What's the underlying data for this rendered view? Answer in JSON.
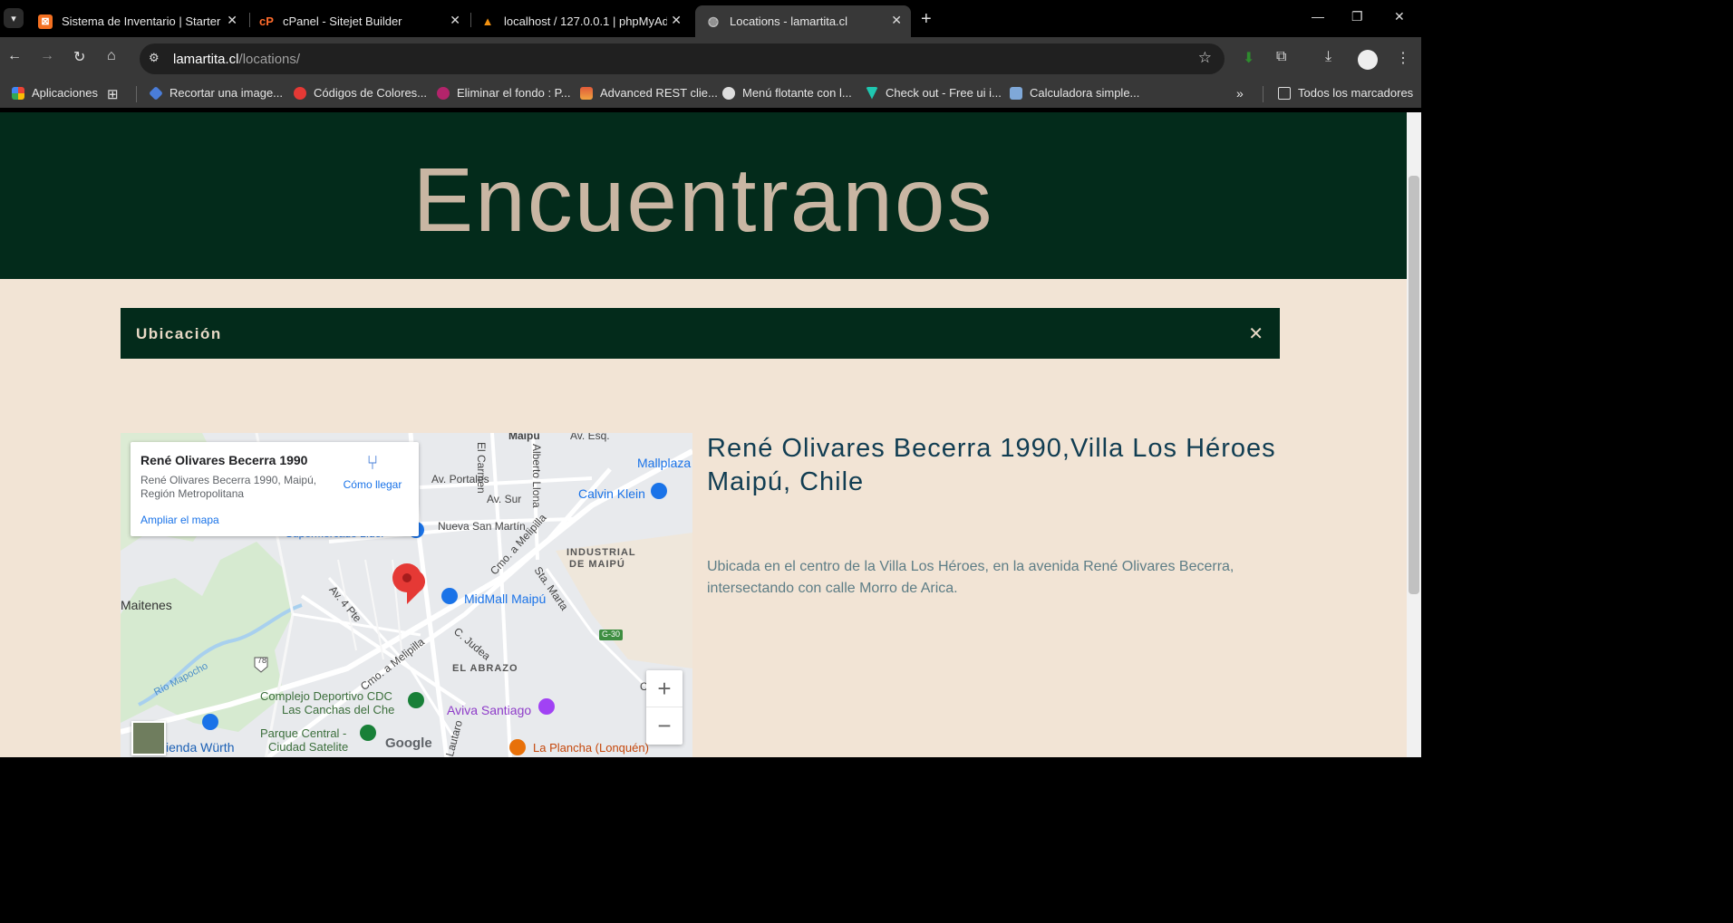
{
  "browser": {
    "tabs": [
      {
        "title": "Sistema de Inventario | Starter",
        "active": false
      },
      {
        "title": "cPanel - Sitejet Builder",
        "active": false
      },
      {
        "title": "localhost / 127.0.0.1 | phpMyAd",
        "active": false
      },
      {
        "title": "Locations - lamartita.cl",
        "active": true
      }
    ],
    "url_host": "lamartita.cl",
    "url_path": "/locations/",
    "bookmarks": [
      "Aplicaciones",
      "Recortar una image...",
      "Códigos de Colores...",
      "Eliminar el fondo : P...",
      "Advanced REST clie...",
      "Menú flotante con l...",
      "Check out - Free ui i...",
      "Calculadora simple..."
    ],
    "all_bookmarks": "Todos los marcadores"
  },
  "page": {
    "hero_title": "Encuentranos",
    "accordion_label": "Ubicación",
    "address_heading": "René Olivares Becerra 1990,Villa Los Héroes Maipú, Chile",
    "description": "Ubicada en el centro de la Villa Los Héroes, en la avenida René Olivares Becerra, intersectando con calle Morro de Arica."
  },
  "map": {
    "card_title": "René Olivares Becerra 1990",
    "card_address": "René Olivares Becerra 1990, Maipú, Región Metropolitana",
    "directions_label": "Cómo llegar",
    "enlarge_label": "Ampliar el mapa",
    "google_label": "Google",
    "labels": {
      "maipu": "Maipú",
      "av_esq": "Av. Esq.",
      "mallplaza": "Mallplaza",
      "el_carmen": "El Carmen",
      "alberto_llona": "Alberto Llona",
      "av_portales": "Av. Portales",
      "av_sur": "Av. Sur",
      "calvin_klein": "Calvin Klein",
      "nueva_san_martin": "Nueva San Martín",
      "supermercado": "Supermercado Líder",
      "cmo_melipilla_1": "Cmo. a Melipilla",
      "industrial": "INDUSTRIAL",
      "de_maipu": "DE MAIPÚ",
      "sta_marta": "Sta. Marta",
      "maitenes": "Maitenes",
      "av_4_pte": "Av. 4 Pte",
      "midmall": "MidMall Maipú",
      "g30": "G-30",
      "c_judea": "C. Judea",
      "r78": "78",
      "cmo_melipilla_2": "Cmo. a Melipilla",
      "el_abrazo": "EL ABRAZO",
      "rio_mapocho": "Río Mapocho",
      "complejo_1": "Complejo Deportivo CDC",
      "complejo_2": "Las Canchas del Che",
      "aviva": "Aviva Santiago",
      "parque_1": "Parque Central -",
      "parque_2": "Ciudad Satelite",
      "lautaro": "Lautaro",
      "wurth": "ienda Würth",
      "la_plancha": "La Plancha (Lonquén)",
      "c_edge": "C"
    }
  },
  "colors": {
    "hero_bg": "#032b1b",
    "page_bg": "#f2e4d5",
    "hero_text": "#c9b6a3",
    "heading_text": "#113d52",
    "desc_text": "#5d7d86"
  }
}
